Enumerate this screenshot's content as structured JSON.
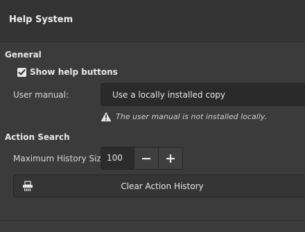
{
  "header": {
    "title": "Help System"
  },
  "general": {
    "section_title": "General",
    "show_help_buttons": {
      "label": "Show help buttons",
      "checked": true
    },
    "user_manual": {
      "label": "User manual:",
      "value": "Use a locally installed copy",
      "warning": "The user manual is not installed locally."
    }
  },
  "action_search": {
    "section_title": "Action Search",
    "history": {
      "label": "Maximum History Size:",
      "value": "100"
    },
    "clear_button": {
      "label": "Clear Action History",
      "icon": "shredder-icon"
    }
  },
  "icons": {
    "checkmark": "check-icon",
    "warning": "warning-icon",
    "minus": "minus-icon",
    "plus": "plus-icon"
  }
}
